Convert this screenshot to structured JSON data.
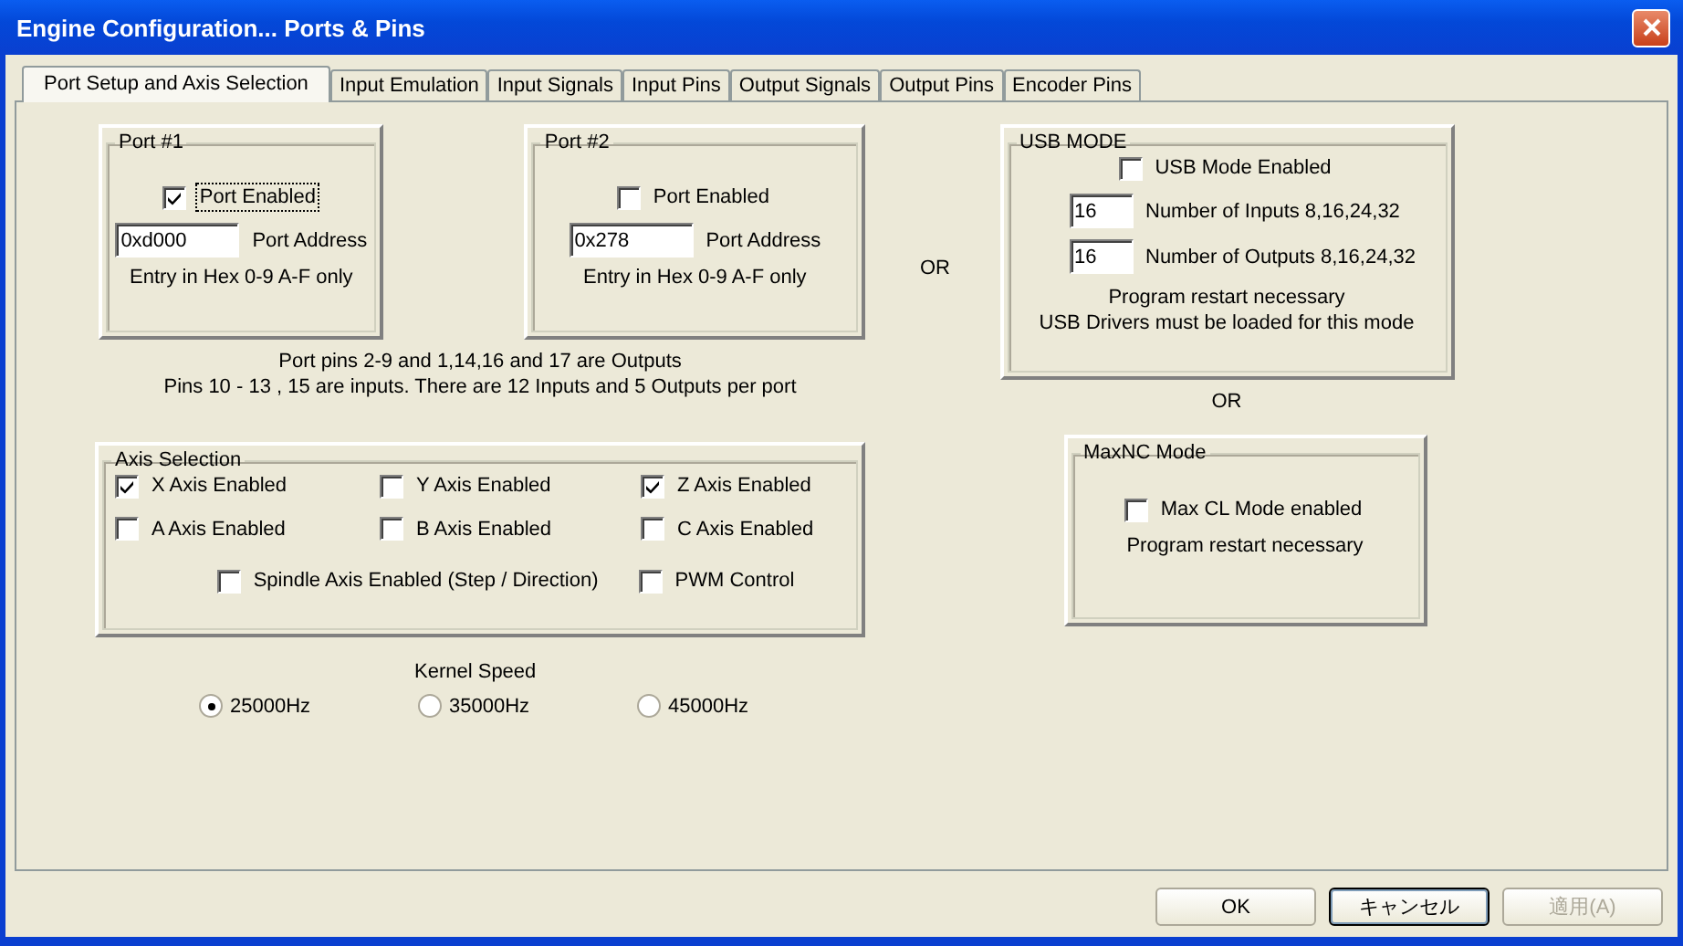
{
  "window": {
    "title": "Engine Configuration... Ports & Pins"
  },
  "tabs": [
    {
      "label": "Port Setup and Axis Selection",
      "selected": true
    },
    {
      "label": "Input Emulation",
      "selected": false
    },
    {
      "label": "Input Signals",
      "selected": false
    },
    {
      "label": "Input Pins",
      "selected": false
    },
    {
      "label": "Output Signals",
      "selected": false
    },
    {
      "label": "Output Pins",
      "selected": false
    },
    {
      "label": "Encoder Pins",
      "selected": false
    }
  ],
  "ports": [
    {
      "title": "Port #1",
      "enabled": {
        "label": "Port Enabled",
        "checked": true,
        "focused": true
      },
      "address": {
        "value": "0xd000",
        "label": "Port Address"
      },
      "hint": "Entry in Hex 0-9 A-F only"
    },
    {
      "title": "Port #2",
      "enabled": {
        "label": "Port Enabled",
        "checked": false,
        "focused": false
      },
      "address": {
        "value": "0x278",
        "label": "Port Address"
      },
      "hint": "Entry in Hex 0-9 A-F only"
    }
  ],
  "port_notes": [
    "Port pins 2-9 and 1,14,16 and 17 are Outputs",
    "Pins 10 - 13 , 15 are inputs. There are 12 Inputs and 5 Outputs per port"
  ],
  "or_middle": "OR",
  "usb_mode": {
    "title": "USB MODE",
    "enabled": {
      "label": "USB Mode Enabled",
      "checked": false
    },
    "fields": [
      {
        "value": "16",
        "label": "Number of Inputs 8,16,24,32"
      },
      {
        "value": "16",
        "label": "Number of Outputs 8,16,24,32"
      }
    ],
    "notes": [
      "Program restart necessary",
      "USB Drivers must be loaded for this mode"
    ]
  },
  "or_right": "OR",
  "axis_selection": {
    "title": "Axis Selection",
    "axes": [
      {
        "label": "X Axis Enabled",
        "checked": true
      },
      {
        "label": "Y Axis Enabled",
        "checked": false
      },
      {
        "label": "Z Axis Enabled",
        "checked": true
      },
      {
        "label": "A Axis Enabled",
        "checked": false
      },
      {
        "label": "B Axis Enabled",
        "checked": false
      },
      {
        "label": "C Axis Enabled",
        "checked": false
      }
    ],
    "extras": [
      {
        "label": "Spindle Axis Enabled (Step / Direction)",
        "checked": false
      },
      {
        "label": "PWM Control",
        "checked": false
      }
    ]
  },
  "kernel_speed": {
    "label": "Kernel Speed",
    "options": [
      {
        "label": "25000Hz",
        "selected": true
      },
      {
        "label": "35000Hz",
        "selected": false
      },
      {
        "label": "45000Hz",
        "selected": false
      }
    ]
  },
  "maxnc_mode": {
    "title": "MaxNC Mode",
    "enabled": {
      "label": "Max CL Mode enabled",
      "checked": false
    },
    "note": "Program restart necessary"
  },
  "buttons": [
    {
      "label": "OK",
      "default": false,
      "disabled": false
    },
    {
      "label": "キャンセル",
      "default": true,
      "disabled": false
    },
    {
      "label": "適用(A)",
      "default": false,
      "disabled": true
    }
  ]
}
